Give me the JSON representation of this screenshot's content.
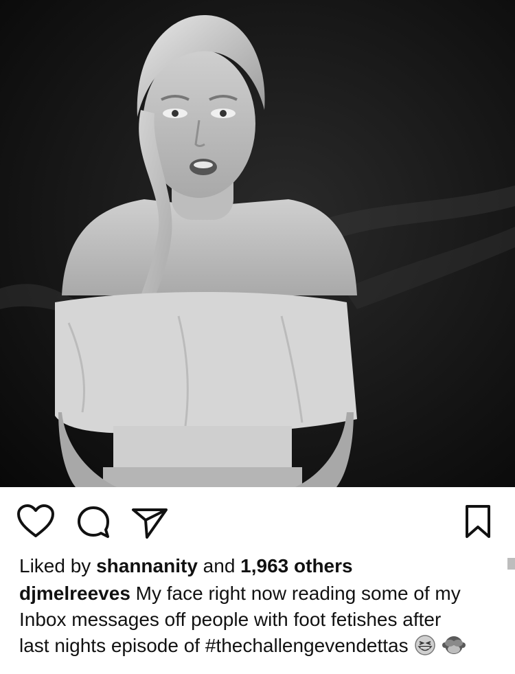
{
  "post": {
    "photo_alt": "",
    "liked_by_prefix": "Liked by",
    "liked_by_user": "shannanity",
    "liked_by_joiner": "and",
    "liked_by_count": "1,963 others",
    "caption_user": "djmelreeves",
    "caption_line1": "My face right now reading some of my",
    "caption_line2": "Inbox messages off people with foot fetishes after",
    "caption_line3": "last nights episode of #thechallengevendettas"
  },
  "icons": {
    "like": "heart-icon",
    "comment": "comment-icon",
    "share": "share-icon",
    "save": "bookmark-icon",
    "emoji1": "grinning-squinting-face-emoji",
    "emoji2": "see-no-evil-monkey-emoji"
  },
  "colors": {
    "text": "#111111",
    "photo_background": "#0d0d0d",
    "icon_stroke": "#111111"
  }
}
